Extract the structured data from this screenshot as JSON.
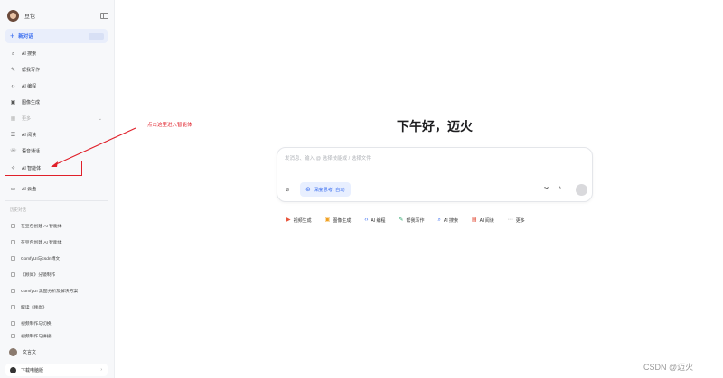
{
  "sidebar": {
    "user_name": "豆包",
    "new_chat_label": "新对话",
    "items": [
      {
        "label": "AI 搜索",
        "icon": "search-icon"
      },
      {
        "label": "帮我写作",
        "icon": "pen-icon"
      },
      {
        "label": "AI 编程",
        "icon": "code-icon"
      },
      {
        "label": "图像生成",
        "icon": "image-icon"
      },
      {
        "label": "更多",
        "icon": "more-icon"
      },
      {
        "label": "AI 阅读",
        "icon": "read-icon"
      },
      {
        "label": "语音通话",
        "icon": "phone-icon"
      },
      {
        "label": "AI 智能体",
        "icon": "sparkle-icon"
      },
      {
        "label": "AI 云盘",
        "icon": "folder-icon"
      }
    ],
    "history_title": "历史对话",
    "history": [
      "在豆包创建 AI 智能体",
      "在豆包创建 AI 智能体",
      "ComfyUI与csdn博文",
      "《顾尚》分镜制作",
      "ComfyUI 黑图分析及解决方案",
      "解读《顾尚》",
      "视频制作与切换",
      "视频制作与拼接"
    ],
    "user_label": "文言文",
    "download_label": "下载电脑版"
  },
  "annotation": {
    "text": "点击这里进入智能体",
    "color": "#e0202a"
  },
  "main": {
    "greeting": "下午好，迈火",
    "composer": {
      "placeholder": "发消息、输入 @ 选择技能或 / 选择文件",
      "deep_think_label": "深度思考: 自动"
    },
    "chips": [
      {
        "label": "视频生成",
        "icon": "video-icon",
        "color": "#e8543a"
      },
      {
        "label": "图像生成",
        "icon": "image-icon",
        "color": "#f0a020"
      },
      {
        "label": "AI 编程",
        "icon": "code-icon",
        "color": "#3b6ef0"
      },
      {
        "label": "帮我写作",
        "icon": "pen-icon",
        "color": "#2aa56a"
      },
      {
        "label": "AI 搜索",
        "icon": "search-icon",
        "color": "#3b6ef0"
      },
      {
        "label": "AI 阅读",
        "icon": "read-icon",
        "color": "#e0402a"
      },
      {
        "label": "更多",
        "icon": "grid-icon",
        "color": "#888888"
      }
    ]
  },
  "watermark": "CSDN @迈火"
}
